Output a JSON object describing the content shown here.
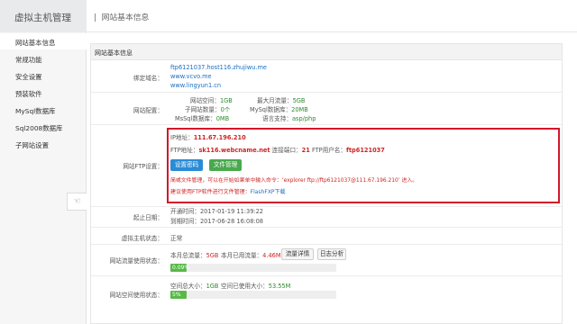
{
  "sidebar": {
    "brand": "虚拟主机管理",
    "items": [
      {
        "label": "网站基本信息",
        "active": true
      },
      {
        "label": "常规功能",
        "active": false
      },
      {
        "label": "安全设置",
        "active": false
      },
      {
        "label": "预装软件",
        "active": false
      },
      {
        "label": "MySql数据库",
        "active": false
      },
      {
        "label": "Sql2008数据库",
        "active": false
      },
      {
        "label": "子网站设置",
        "active": false
      }
    ],
    "collapse_icon": "hand-pointer-icon"
  },
  "header": {
    "title": "网站基本信息"
  },
  "panel": {
    "title": "网站基本信息",
    "domain": {
      "label": "绑定域名：",
      "values": [
        "ftp6121037.host116.zhujiwu.me",
        "www.vcvo.me",
        "www.lingyun1.cn"
      ]
    },
    "config": {
      "label": "网站配置：",
      "site_space_label": "网站空间：",
      "site_space": "1GB",
      "max_traffic_label": "最大月流量：",
      "max_traffic": "5GB",
      "subsites_label": "子网站数量：",
      "subsites": "0个",
      "mysql_size_label": "MySql数据库：",
      "mysql_size": "20MB",
      "mssql_size_label": "MsSql数据库：",
      "mssql_size": "0MB",
      "lang_label": "语言支持：",
      "lang": "asp/php"
    },
    "ftp": {
      "label": "网站FTP设置：",
      "ip_label": "IP地址：",
      "ip": "111.67.196.210",
      "ftp_addr_label": "FTP地址：",
      "ftp_addr": "sk116.webcname.net",
      "port_label": "连接端口：",
      "port": "21",
      "user_label": "FTP用户名：",
      "user": "ftp6121037",
      "btn_password": "设置密码",
      "btn_files": "文件管理",
      "note1": "简或文件管理，可以在开始如果单中输入命令：‘explorer ftp://ftp6121037@111.67.196.210’ 进入。",
      "note2_prefix": "建议使用FTP软件进行文件管理：",
      "note2_link": "FlashFXP下载"
    },
    "dates": {
      "label": "起止日期：",
      "open_label": "开通时间：",
      "open": "2017-01-19 11:39:22",
      "expire_label": "到期时间：",
      "expire": "2017-06-28 16:08:08"
    },
    "status": {
      "label": "虚拟主机状态：",
      "value": "正常"
    },
    "traffic": {
      "label": "网站流量使用状态：",
      "total_label": "本月总流量：",
      "total": "5GB",
      "used_label": "本月已用流量：",
      "used": "4.46M",
      "btn_detail": "流量详情",
      "btn_log": "日志分析",
      "percent_text": "0.09%",
      "percent": 0.0009
    },
    "space": {
      "label": "网站空间使用状态：",
      "total_label": "空间总大小：",
      "total": "1GB",
      "used_label": "空间已使用大小：",
      "used": "53.55M",
      "percent_text": "5%",
      "percent": 0.05
    }
  },
  "colors": {
    "highlight_border": "#d3172a",
    "accent_blue": "#2a8bd6",
    "accent_green": "#49a94d"
  }
}
